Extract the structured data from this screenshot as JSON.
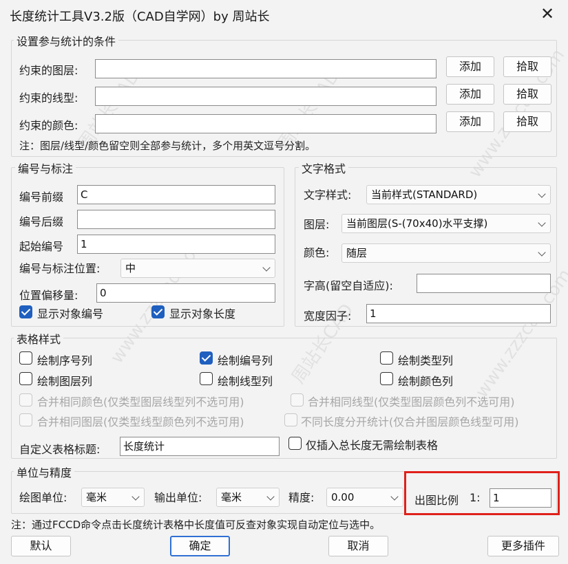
{
  "window": {
    "title": "长度统计工具V3.2版（CAD自学网）by 周站长",
    "close_symbol": "✕"
  },
  "conditions": {
    "title": "设置参与统计的条件",
    "rows": [
      {
        "label": "约束的图层:",
        "value": "",
        "add": "添加",
        "pick": "拾取"
      },
      {
        "label": "约束的线型:",
        "value": "",
        "add": "添加",
        "pick": "拾取"
      },
      {
        "label": "约束的颜色:",
        "value": "",
        "add": "添加",
        "pick": "拾取"
      }
    ],
    "note": "注：图层/线型/颜色留空则全部参与统计，多个用英文逗号分割。"
  },
  "numbering": {
    "title": "编号与标注",
    "prefix_label": "编号前缀",
    "prefix_value": "C",
    "suffix_label": "编号后缀",
    "suffix_value": "",
    "start_label": "起始编号",
    "start_value": "1",
    "position_label": "编号与标注位置:",
    "position_value": "中",
    "offset_label": "位置偏移量:",
    "offset_value": "0",
    "show_number_label": "显示对象编号",
    "show_number_checked": true,
    "show_length_label": "显示对象长度",
    "show_length_checked": true
  },
  "text_format": {
    "title": "文字格式",
    "style_label": "文字样式:",
    "style_value": "当前样式(STANDARD)",
    "layer_label": "图层:",
    "layer_value": "当前图层(S-(70x40)水平支撑)",
    "color_label": "颜色:",
    "color_value": "随层",
    "height_label": "字高(留空自适应):",
    "height_value": "",
    "width_label": "宽度因子:",
    "width_value": "1"
  },
  "table_style": {
    "title": "表格样式",
    "options": [
      {
        "label": "绘制序号列",
        "checked": false
      },
      {
        "label": "绘制编号列",
        "checked": true
      },
      {
        "label": "绘制类型列",
        "checked": false
      },
      {
        "label": "绘制图层列",
        "checked": false
      },
      {
        "label": "绘制线型列",
        "checked": false
      },
      {
        "label": "绘制颜色列",
        "checked": false
      }
    ],
    "disabled_options": [
      "合并相同颜色(仅类型图层线型列不选可用)",
      "合并相同线型(仅类型图层颜色列不选可用)",
      "合并相同图层(仅类型线型颜色列不选可用)",
      "不同长度分开统计(仅合并图层颜色线型可用)"
    ],
    "custom_title_label": "自定义表格标题:",
    "custom_title_value": "长度统计",
    "insert_only_label": "仅插入总长度无需绘制表格",
    "insert_only_checked": false
  },
  "units": {
    "title": "单位与精度",
    "draw_unit_label": "绘图单位:",
    "draw_unit_value": "毫米",
    "output_unit_label": "输出单位:",
    "output_unit_value": "毫米",
    "precision_label": "精度:",
    "precision_value": "0.00",
    "scale_label": "出图比例",
    "scale_prefix": "1:",
    "scale_value": "1"
  },
  "footer_note": "注：通过FCCD命令点击长度统计表格中长度值可反查对象实现自动定位与选中。",
  "buttons": {
    "default": "默认",
    "ok": "确定",
    "cancel": "取消",
    "more": "更多插件"
  },
  "watermarks": [
    "周站长CAD",
    "www.zzzcad.com"
  ],
  "colors": {
    "accent": "#1f5fbf",
    "highlight": "#e0201a",
    "background": "#f3f3f3"
  }
}
